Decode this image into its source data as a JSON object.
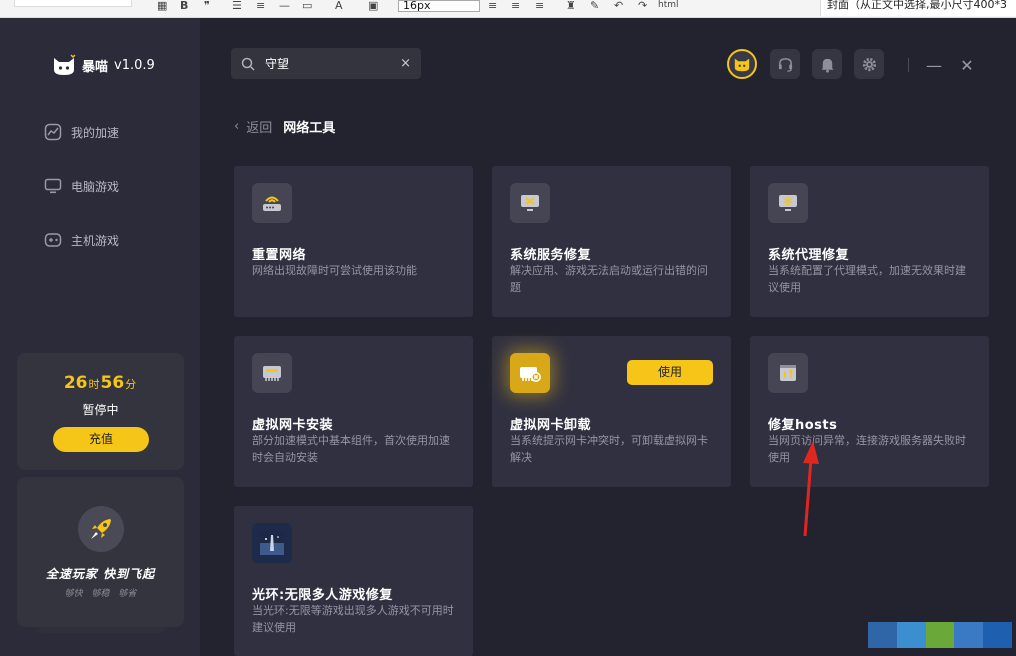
{
  "editor_toolbar": {
    "font_size_value": "16px",
    "html_label": "html",
    "hint_text": "封面（从正文中选择,最小尺寸400*3"
  },
  "sidebar": {
    "brand": "暴喵",
    "version": "v1.0.9",
    "nav": [
      {
        "label": "我的加速",
        "icon": "speed-chart-icon"
      },
      {
        "label": "电脑游戏",
        "icon": "monitor-icon"
      },
      {
        "label": "主机游戏",
        "icon": "gamepad-icon"
      }
    ],
    "time_card": {
      "hours": "26",
      "hours_unit": "时",
      "minutes": "56",
      "minutes_unit": "分",
      "status": "暂停中",
      "recharge_label": "充值"
    },
    "promo": {
      "slogan": "全速玩家  快到飞起",
      "tags": [
        "够快",
        "够稳",
        "够省"
      ]
    }
  },
  "header": {
    "search_value": "守望",
    "clear_symbol": "×",
    "icons": [
      "avatar",
      "headset-icon",
      "bell-icon",
      "gear-icon"
    ],
    "minimize_symbol": "—",
    "close_symbol": "✕"
  },
  "breadcrumb": {
    "back_label": "返回",
    "title": "网络工具"
  },
  "tools": [
    {
      "name": "重置网络",
      "desc": "网络出现故障时可尝试使用该功能",
      "icon": "router-reset-icon"
    },
    {
      "name": "系统服务修复",
      "desc": "解决应用、游戏无法启动或运行出错的问题",
      "icon": "monitor-tools-icon"
    },
    {
      "name": "系统代理修复",
      "desc": "当系统配置了代理模式，加速无效果时建议使用",
      "icon": "monitor-gear-icon"
    },
    {
      "name": "虚拟网卡安装",
      "desc": "部分加速模式中基本组件，首次使用加速时会自动安装",
      "icon": "network-card-icon"
    },
    {
      "name": "虚拟网卡卸载",
      "desc": "当系统提示网卡冲突时，可卸载虚拟网卡解决",
      "icon": "network-card-remove-icon",
      "action_label": "使用"
    },
    {
      "name": "修复hosts",
      "desc": "当网页访问异常，连接游戏服务器失败时使用",
      "icon": "hosts-repair-icon"
    },
    {
      "name": "光环:无限多人游戏修复",
      "desc": "当光环:无限等游戏出现多人游戏不可用时建议使用",
      "icon": "halo-game-thumbnail"
    }
  ],
  "colors": {
    "accent": "#f5c518",
    "sidebar_bg": "#2b2b39",
    "main_bg": "#23232f",
    "card_bg": "#303040",
    "annotation_arrow": "#e0271f"
  }
}
